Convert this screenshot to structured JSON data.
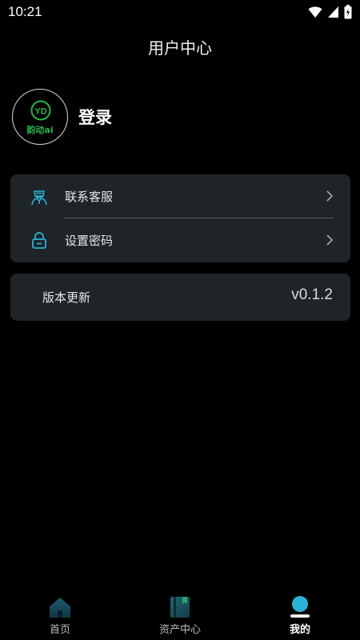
{
  "status_bar": {
    "time": "10:21"
  },
  "header": {
    "title": "用户中心"
  },
  "profile": {
    "avatar_text": "韵动ai",
    "logo_text": "YD",
    "login_label": "登录"
  },
  "menu": {
    "items": [
      {
        "label": "联系客服",
        "icon": "customer-service-icon"
      },
      {
        "label": "设置密码",
        "icon": "lock-icon"
      }
    ]
  },
  "version": {
    "label": "版本更新",
    "value": "v0.1.2"
  },
  "bottom_nav": {
    "items": [
      {
        "label": "首页",
        "icon": "home-icon"
      },
      {
        "label": "资产中心",
        "icon": "assets-icon"
      },
      {
        "label": "我的",
        "icon": "profile-icon",
        "active": true
      }
    ]
  },
  "colors": {
    "accent": "#2ab3d6",
    "brand_green": "#28b34b",
    "card_bg": "#1e2428"
  }
}
